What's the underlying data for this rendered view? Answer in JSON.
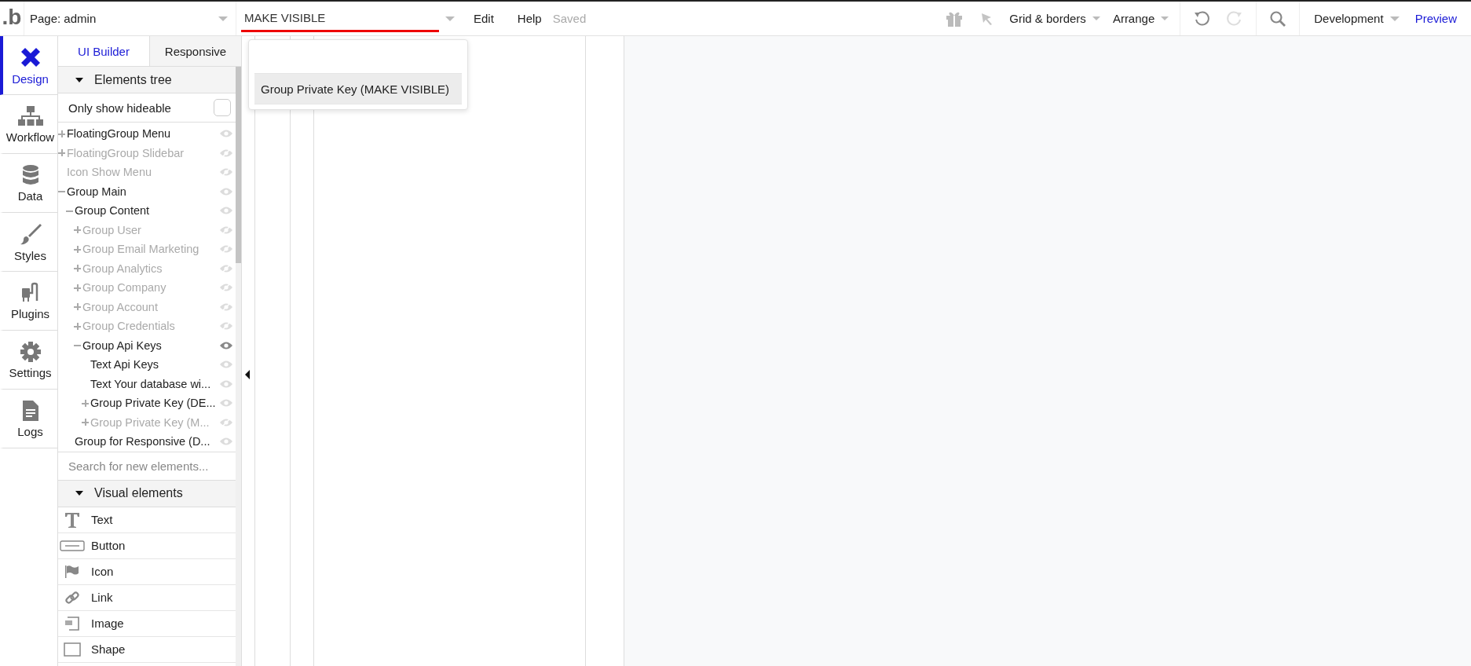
{
  "top_bar": {
    "logo": ".b",
    "page_select": "Page: admin",
    "element_search": {
      "value": "MAKE VISIBLE"
    },
    "menu": [
      "Edit",
      "Help"
    ],
    "save_status": "Saved",
    "grid_menu": "Grid & borders",
    "arrange_menu": "Arrange",
    "version_select": "Development",
    "preview": "Preview"
  },
  "search_results": [
    {
      "label": "Group Private Key (MAKE VISIBLE)",
      "selected": true
    }
  ],
  "rail": [
    {
      "label": "Design",
      "selected": true,
      "kind": "design"
    },
    {
      "label": "Workflow",
      "selected": false,
      "kind": "workflow"
    },
    {
      "label": "Data",
      "selected": false,
      "kind": "data"
    },
    {
      "label": "Styles",
      "selected": false,
      "kind": "styles"
    },
    {
      "label": "Plugins",
      "selected": false,
      "kind": "plugins"
    },
    {
      "label": "Settings",
      "selected": false,
      "kind": "settings"
    },
    {
      "label": "Logs",
      "selected": false,
      "kind": "logs"
    }
  ],
  "panel_tabs": [
    {
      "label": "UI Builder",
      "selected": true
    },
    {
      "label": "Responsive",
      "selected": false
    }
  ],
  "elements_tree": {
    "title": "Elements tree",
    "only_show_hideable": {
      "label": "Only show hideable",
      "checked": false
    },
    "items": [
      {
        "label": "FloatingGroup Menu",
        "expanded": false,
        "hidden": false,
        "selected": false
      },
      {
        "label": "FloatingGroup Slidebar",
        "expanded": false,
        "hidden": true,
        "selected": false
      },
      {
        "label": "Icon Show Menu",
        "hidden": true,
        "selected": false
      },
      {
        "label": "Group Main",
        "expanded": true,
        "hidden": false,
        "selected": false,
        "children": [
          {
            "label": "Group Content",
            "expanded": true,
            "hidden": false,
            "selected": false,
            "children": [
              {
                "label": "Group User",
                "expanded": false,
                "hidden": true,
                "selected": false
              },
              {
                "label": "Group Email Marketing",
                "expanded": false,
                "hidden": true,
                "selected": false
              },
              {
                "label": "Group Analytics",
                "expanded": false,
                "hidden": true,
                "selected": false
              },
              {
                "label": "Group Company",
                "expanded": false,
                "hidden": true,
                "selected": false
              },
              {
                "label": "Group Account",
                "expanded": false,
                "hidden": true,
                "selected": false
              },
              {
                "label": "Group Credentials",
                "expanded": false,
                "hidden": true,
                "selected": false
              },
              {
                "label": "Group Api Keys",
                "expanded": true,
                "hidden": false,
                "selected": true,
                "children": [
                  {
                    "label": "Text Api Keys",
                    "hidden": false,
                    "selected": false
                  },
                  {
                    "label": "Text Your database wi...",
                    "hidden": false,
                    "selected": false
                  },
                  {
                    "label": "Group Private Key (DE...",
                    "expanded": false,
                    "hidden": false,
                    "selected": false
                  },
                  {
                    "label": "Group Private Key (M...",
                    "expanded": false,
                    "hidden": true,
                    "selected": false
                  }
                ]
              }
            ]
          },
          {
            "label": "Group for Responsive (D...",
            "hidden": false,
            "selected": false
          }
        ]
      }
    ]
  },
  "element_search": {
    "placeholder": "Search for new elements..."
  },
  "visual_elements": {
    "title": "Visual elements",
    "items": [
      {
        "label": "Text",
        "kind": "text"
      },
      {
        "label": "Button",
        "kind": "button"
      },
      {
        "label": "Icon",
        "kind": "icon"
      },
      {
        "label": "Link",
        "kind": "link"
      },
      {
        "label": "Image",
        "kind": "image"
      },
      {
        "label": "Shape",
        "kind": "shape"
      }
    ]
  }
}
